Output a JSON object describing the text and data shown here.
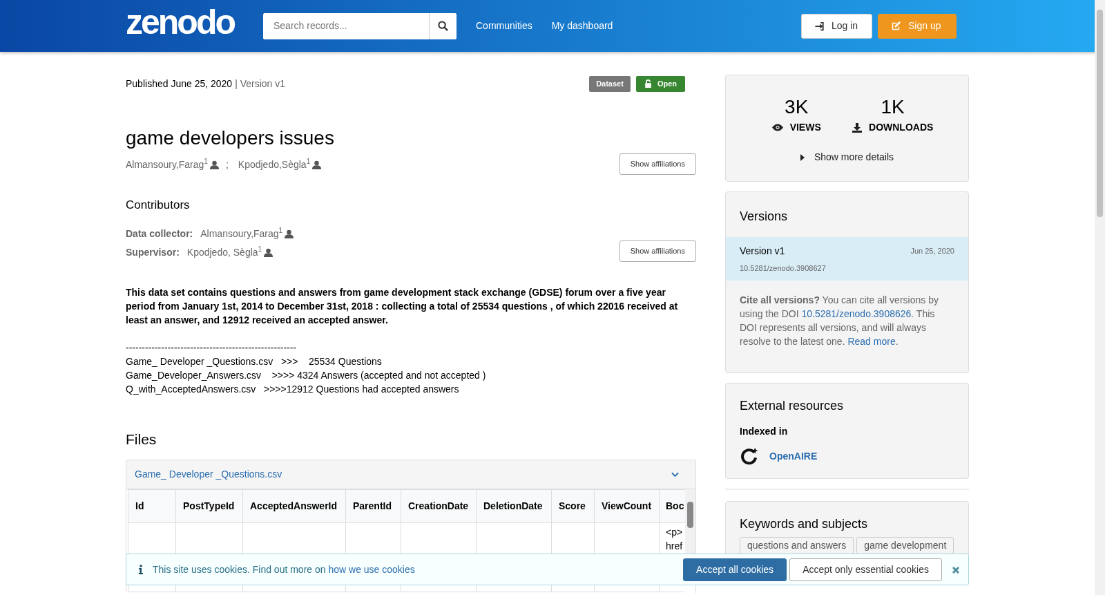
{
  "header": {
    "logo": "zenodo",
    "search": {
      "placeholder": "Search records..."
    },
    "nav": [
      "Communities",
      "My dashboard"
    ],
    "buttons": [
      {
        "label": "Log in",
        "kind": "login"
      },
      {
        "label": "Sign up",
        "kind": "signup"
      }
    ]
  },
  "record": {
    "published": "Published June 25, 2020",
    "version": "| Version v1",
    "badges": [
      {
        "label": "Dataset",
        "kind": "type"
      },
      {
        "label": "Open",
        "kind": "access"
      }
    ],
    "title": "game developers issues",
    "creators": [
      {
        "name": "Almansoury,Farag",
        "sup": "1"
      },
      {
        "name": "Kpodjedo,Sègla",
        "sup": "1"
      }
    ],
    "creator_separator": ";",
    "affiliations_button": "Show affiliations",
    "contributors": {
      "heading": "Contributors",
      "affiliations_button": "Show affiliations",
      "items": [
        {
          "role": "Data collector:",
          "name": "Almansoury,Farag",
          "sup": "1"
        },
        {
          "role": "Supervisor:",
          "name": "Kpodjedo, Sègla",
          "sup": "1"
        }
      ]
    },
    "description": {
      "summary": "This data set contains questions and answers from  game development stack exchange (GDSE)  forum  over a five year period from January 1st, 2014 to December 31st, 2018 : collecting a total of 25534 questions , of which 22016 received at least an answer, and 12912 received an accepted answer.",
      "separator": "-----------------------------------------------------",
      "lines": [
        "Game_ Developer _Questions.csv   >>>    25534 Questions",
        "Game_Developer_Answers.csv    >>>> 4324 Answers (accepted and not accepted )",
        "Q_with_AcceptedAnswers.csv   >>>>12912 Questions had accepted answers"
      ]
    }
  },
  "files": {
    "heading": "Files",
    "file_name": "Game_ Developer _Questions.csv",
    "expanded": true,
    "table": {
      "columns": [
        "Id",
        "PostTypeId",
        "AcceptedAnswerId",
        "ParentId",
        "CreationDate",
        "DeletionDate",
        "Score",
        "ViewCount",
        "Boc"
      ],
      "rows": [
        {
          "cells": [
            "",
            "",
            "",
            "",
            "",
            "",
            "",
            "",
            ""
          ],
          "body_lines": [
            "<p>",
            "href"
          ]
        }
      ]
    }
  },
  "sidebar": {
    "stats": [
      {
        "value": "3K",
        "label": "VIEWS",
        "kind": "views"
      },
      {
        "value": "1K",
        "label": "DOWNLOADS",
        "kind": "downloads"
      }
    ],
    "details_toggle": {
      "label": "Show more details",
      "expanded": false
    },
    "versions": {
      "heading": "Versions",
      "items": [
        {
          "title": "Version v1",
          "date": "Jun 25, 2020",
          "doi": "10.5281/zenodo.3908627",
          "selected": true
        }
      ],
      "cite": [
        {
          "kind": "bold",
          "text": "Cite all versions?"
        },
        {
          "kind": "text",
          "text": " You can cite all versions by using the DOI "
        },
        {
          "kind": "link",
          "text": "10.5281/zenodo.3908626"
        },
        {
          "kind": "text",
          "text": ". This DOI represents all versions, and will always resolve to the latest one. "
        },
        {
          "kind": "link",
          "text": "Read more"
        },
        {
          "kind": "text",
          "text": "."
        }
      ]
    },
    "external": {
      "heading": "External resources",
      "subheading": "Indexed in",
      "items": [
        {
          "name": "OpenAIRE"
        }
      ]
    },
    "keywords": {
      "heading": "Keywords and subjects",
      "tags": [
        "questions and answers",
        "game development"
      ]
    }
  },
  "cookie_banner": {
    "text": "This site uses cookies. Find out more on ",
    "link": "how we use cookies",
    "buttons": [
      {
        "label": "Accept all cookies",
        "kind": "primary"
      },
      {
        "label": "Accept only essential cookies",
        "kind": "secondary"
      }
    ]
  }
}
